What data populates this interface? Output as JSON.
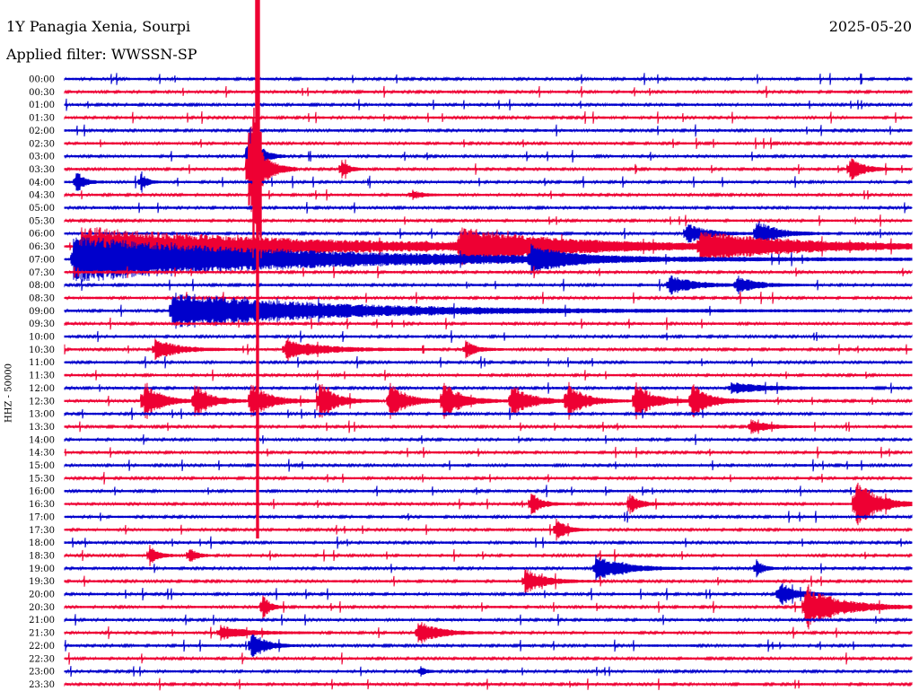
{
  "header": {
    "station": "1Y Panagia Xenia, Sourpi",
    "date": "2025-05-20",
    "filter_text": "Applied filter: WWSSN-SP",
    "channel_label": "HHZ - 50000"
  },
  "colors": {
    "blue": "#0000cc",
    "red": "#ee0033"
  },
  "chart_data": {
    "type": "line",
    "title": "1Y Panagia Xenia, Sourpi",
    "ylabel": "HHZ - 50000",
    "row_labels": [
      "00:00",
      "00:30",
      "01:00",
      "01:30",
      "02:00",
      "02:30",
      "03:00",
      "03:30",
      "04:00",
      "04:30",
      "05:00",
      "05:30",
      "06:00",
      "06:30",
      "07:00",
      "07:30",
      "08:00",
      "08:30",
      "09:00",
      "09:30",
      "10:00",
      "10:30",
      "11:00",
      "11:30",
      "12:00",
      "12:30",
      "13:00",
      "13:30",
      "14:00",
      "14:30",
      "15:00",
      "15:30",
      "16:00",
      "16:30",
      "17:00",
      "17:30",
      "18:00",
      "18:30",
      "19:00",
      "19:30",
      "20:00",
      "20:30",
      "21:00",
      "21:30",
      "22:00",
      "22:30",
      "23:00",
      "23:30"
    ],
    "row_colors": [
      "blue",
      "red",
      "blue",
      "red",
      "blue",
      "red",
      "blue",
      "red",
      "blue",
      "red",
      "blue",
      "red",
      "blue",
      "red",
      "blue",
      "red",
      "blue",
      "red",
      "blue",
      "red",
      "blue",
      "red",
      "blue",
      "red",
      "blue",
      "red",
      "blue",
      "red",
      "blue",
      "red",
      "blue",
      "red",
      "blue",
      "red",
      "blue",
      "red",
      "blue",
      "red",
      "blue",
      "red",
      "blue",
      "red",
      "blue",
      "red",
      "blue",
      "red",
      "blue",
      "red"
    ],
    "x_minutes": [
      0,
      30
    ],
    "events": [
      {
        "row": 6,
        "minute": 6.5,
        "amp": 40,
        "dur": 0.6
      },
      {
        "row": 7,
        "minute": 6.5,
        "amp": 60,
        "dur": 0.8
      },
      {
        "row": 7,
        "minute": 9.8,
        "amp": 12,
        "dur": 0.4
      },
      {
        "row": 7,
        "minute": 27.8,
        "amp": 14,
        "dur": 0.8
      },
      {
        "row": 8,
        "minute": 0.4,
        "amp": 12,
        "dur": 0.5
      },
      {
        "row": 8,
        "minute": 2.7,
        "amp": 10,
        "dur": 0.4
      },
      {
        "row": 9,
        "minute": 12.3,
        "amp": 5,
        "dur": 0.6
      },
      {
        "row": 12,
        "minute": 22.0,
        "amp": 12,
        "dur": 1.2
      },
      {
        "row": 12,
        "minute": 24.5,
        "amp": 16,
        "dur": 1.2
      },
      {
        "row": 13,
        "minute": 0.6,
        "amp": 22,
        "dur": 14.0
      },
      {
        "row": 13,
        "minute": 14.0,
        "amp": 18,
        "dur": 6.5
      },
      {
        "row": 13,
        "minute": 22.5,
        "amp": 14,
        "dur": 7.0
      },
      {
        "row": 14,
        "minute": 0.3,
        "amp": 26,
        "dur": 15.0
      },
      {
        "row": 14,
        "minute": 16.5,
        "amp": 14,
        "dur": 2.0
      },
      {
        "row": 16,
        "minute": 21.4,
        "amp": 12,
        "dur": 1.4
      },
      {
        "row": 16,
        "minute": 23.8,
        "amp": 10,
        "dur": 1.2
      },
      {
        "row": 18,
        "minute": 3.8,
        "amp": 20,
        "dur": 10.5
      },
      {
        "row": 21,
        "minute": 3.2,
        "amp": 12,
        "dur": 1.4
      },
      {
        "row": 21,
        "minute": 7.8,
        "amp": 10,
        "dur": 2.5
      },
      {
        "row": 21,
        "minute": 14.2,
        "amp": 10,
        "dur": 0.6
      },
      {
        "row": 24,
        "minute": 23.6,
        "amp": 6,
        "dur": 2.2
      },
      {
        "row": 25,
        "minute": 2.8,
        "amp": 24,
        "dur": 1.0
      },
      {
        "row": 25,
        "minute": 4.6,
        "amp": 20,
        "dur": 1.0
      },
      {
        "row": 25,
        "minute": 6.6,
        "amp": 20,
        "dur": 1.2
      },
      {
        "row": 25,
        "minute": 9.0,
        "amp": 22,
        "dur": 1.0
      },
      {
        "row": 25,
        "minute": 11.5,
        "amp": 22,
        "dur": 1.0
      },
      {
        "row": 25,
        "minute": 13.4,
        "amp": 22,
        "dur": 1.1
      },
      {
        "row": 25,
        "minute": 15.8,
        "amp": 22,
        "dur": 1.1
      },
      {
        "row": 25,
        "minute": 17.8,
        "amp": 22,
        "dur": 1.0
      },
      {
        "row": 25,
        "minute": 20.2,
        "amp": 24,
        "dur": 1.0
      },
      {
        "row": 25,
        "minute": 22.2,
        "amp": 20,
        "dur": 1.1
      },
      {
        "row": 27,
        "minute": 24.3,
        "amp": 8,
        "dur": 1.0
      },
      {
        "row": 33,
        "minute": 16.5,
        "amp": 14,
        "dur": 0.6
      },
      {
        "row": 33,
        "minute": 20.0,
        "amp": 12,
        "dur": 0.6
      },
      {
        "row": 33,
        "minute": 28.0,
        "amp": 30,
        "dur": 1.3
      },
      {
        "row": 35,
        "minute": 17.4,
        "amp": 14,
        "dur": 0.6
      },
      {
        "row": 37,
        "minute": 3.0,
        "amp": 12,
        "dur": 0.5
      },
      {
        "row": 37,
        "minute": 4.4,
        "amp": 10,
        "dur": 0.4
      },
      {
        "row": 38,
        "minute": 18.8,
        "amp": 16,
        "dur": 1.6
      },
      {
        "row": 38,
        "minute": 24.5,
        "amp": 10,
        "dur": 0.4
      },
      {
        "row": 39,
        "minute": 16.3,
        "amp": 14,
        "dur": 1.2
      },
      {
        "row": 40,
        "minute": 25.3,
        "amp": 14,
        "dur": 1.0
      },
      {
        "row": 41,
        "minute": 7.0,
        "amp": 16,
        "dur": 0.4
      },
      {
        "row": 41,
        "minute": 26.2,
        "amp": 24,
        "dur": 2.2
      },
      {
        "row": 43,
        "minute": 5.5,
        "amp": 8,
        "dur": 1.6
      },
      {
        "row": 43,
        "minute": 12.5,
        "amp": 14,
        "dur": 1.2
      },
      {
        "row": 44,
        "minute": 6.6,
        "amp": 18,
        "dur": 0.8
      },
      {
        "row": 46,
        "minute": 12.6,
        "amp": 6,
        "dur": 0.3
      }
    ],
    "big_event": {
      "row": 7,
      "minute": 6.8,
      "max_amp": 200
    }
  }
}
